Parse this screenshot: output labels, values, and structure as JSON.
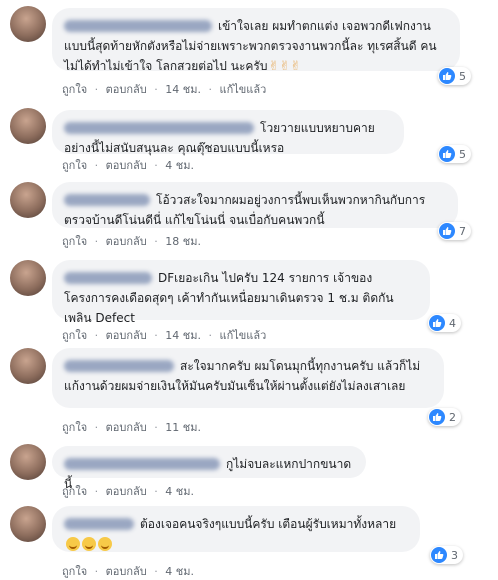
{
  "actions": {
    "like": "ถูกใจ",
    "reply": "ตอบกลับ",
    "see_translation": "แก้ไขแล้ว",
    "sep": "·"
  },
  "comments": [
    {
      "text": "เข้าใจเลย ผมทำตกแต่ง เจอพวกดีเฟกงานแบบนี้สุดท้ายหักตังหรือไม่จ่ายเพราะพวกตรวจงานพวกนี้ละ ทุเรศสิ้นดี คนไม่ได้ทำไม่เข้าใจ โลกสวยต่อไป นะครับ",
      "hands": "✌✌✌",
      "time": "14 ชม.",
      "edited": "แก้ไขแล้ว",
      "reactions": "5"
    },
    {
      "text": "โวยวายแบบหยาบคายอย่างนี้ไม่สนับสนุนละ คุณตุ๊ชอบแบบนี้เหรอ",
      "time": "4 ชม.",
      "reactions": "5"
    },
    {
      "text": "โอ้ววสะใจมากผมอยู่วงการนี้พบเห็นพวกหากินกับการตรวจบ้านดีโน่นดีนี่ แก้ไขโน่นนี่ จนเบื่อกับคนพวกนี้",
      "time": "18 ชม.",
      "reactions": "7"
    },
    {
      "text": "DFเยอะเกิน ไปครับ 124 รายการ เจ้าของโครงการคงเดือดสุดๆ เค้าทำกันเหนื่อยมาเดินตรวจ 1 ช.ม ติดกันเพลิน Defect",
      "time": "14 ชม.",
      "edited": "แก้ไขแล้ว",
      "reactions": "4"
    },
    {
      "text": "สะใจมากครับ ผมโดนมุกนี้ทุกงานครับ แล้วก็ไม่แก้งานด้วยผมจ่ายเงินให้มันครับมันเซ็นให้ผ่านตั้งแต่ยังไม่ลงเสาเลย",
      "time": "11 ชม.",
      "reactions": "2"
    },
    {
      "text": "กูไม่จบละแหกปากขนาดนี้",
      "time": "4 ชม."
    },
    {
      "text": "ต้องเจอคนจริงๆแบบนี้ครับ เตือนผู้รับเหมาทั้งหลาย",
      "time": "4 ชม.",
      "reactions": "3"
    }
  ]
}
